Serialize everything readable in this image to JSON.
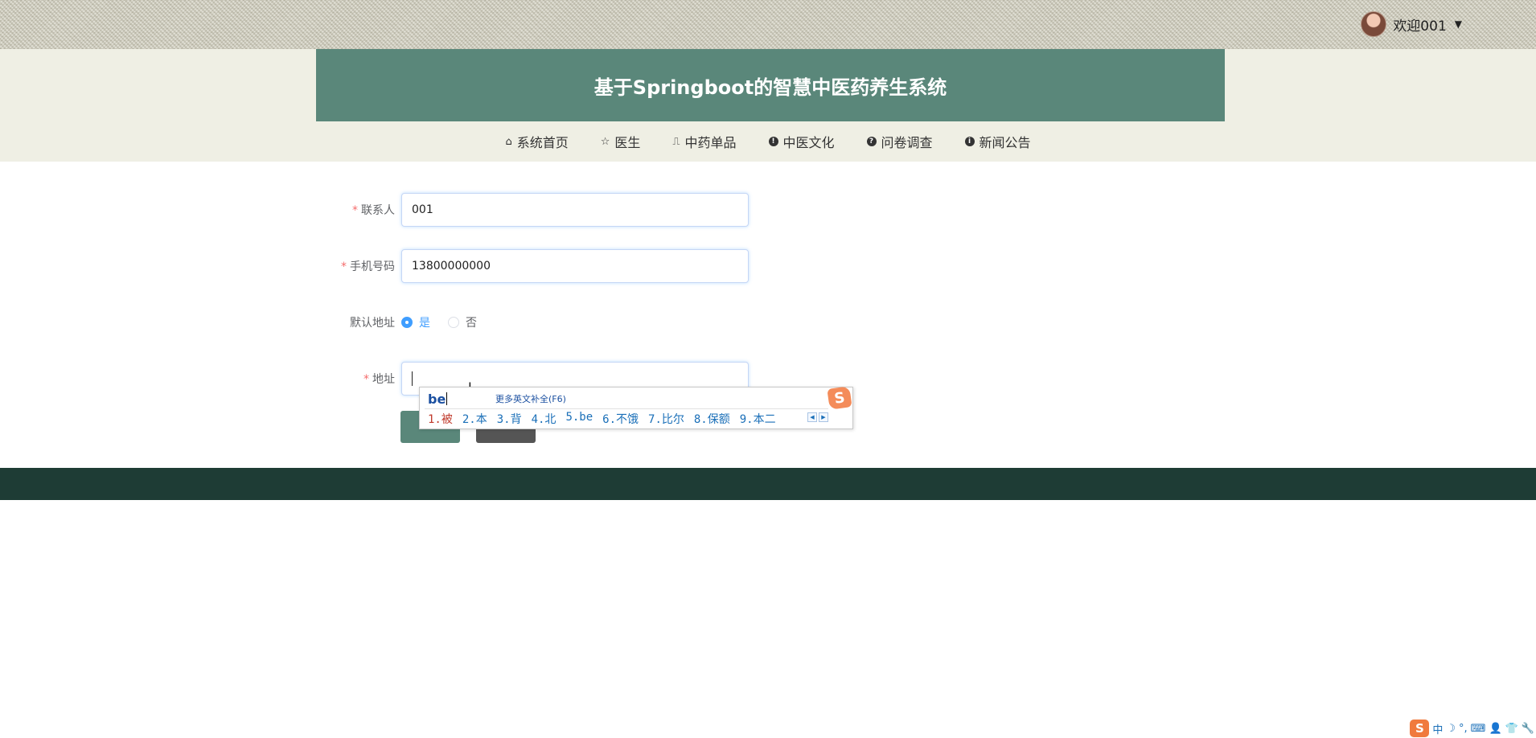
{
  "header": {
    "user_greeting": "欢迎001",
    "site_title": "基于Springboot的智慧中医药养生系统"
  },
  "nav": {
    "items": [
      {
        "label": "系统首页",
        "icon": "home-icon"
      },
      {
        "label": "医生",
        "icon": "star-icon"
      },
      {
        "label": "中药单品",
        "icon": "bag-icon"
      },
      {
        "label": "中医文化",
        "icon": "exclamation-circle-icon"
      },
      {
        "label": "问卷调查",
        "icon": "question-circle-icon"
      },
      {
        "label": "新闻公告",
        "icon": "info-circle-icon"
      }
    ]
  },
  "form": {
    "contact": {
      "label": "联系人",
      "value": "001"
    },
    "phone": {
      "label": "手机号码",
      "value": "13800000000"
    },
    "default_address": {
      "label": "默认地址",
      "option_yes": "是",
      "option_no": "否",
      "selected": "是"
    },
    "address": {
      "label": "地址",
      "value": ""
    },
    "required_mark": "*"
  },
  "ime": {
    "composition": "be",
    "more_hint": "更多英文补全(F6)",
    "logo": "S",
    "candidates": [
      "1.被",
      "2.本",
      "3.背",
      "4.北",
      "5.be",
      "6.不饿",
      "7.比尔",
      "8.保额",
      "9.本二"
    ],
    "pager_prev": "◀",
    "pager_next": "▶"
  },
  "tray": {
    "logo": "S",
    "mode": "中",
    "items": [
      "☽",
      "°,",
      "⌨",
      "👤",
      "👕",
      "🔧"
    ]
  },
  "colors": {
    "title_bg": "#5a877a",
    "header_bg": "#efefe4",
    "footer_bg": "#1e3c35",
    "accent": "#409eff",
    "required": "#f56c6c"
  }
}
